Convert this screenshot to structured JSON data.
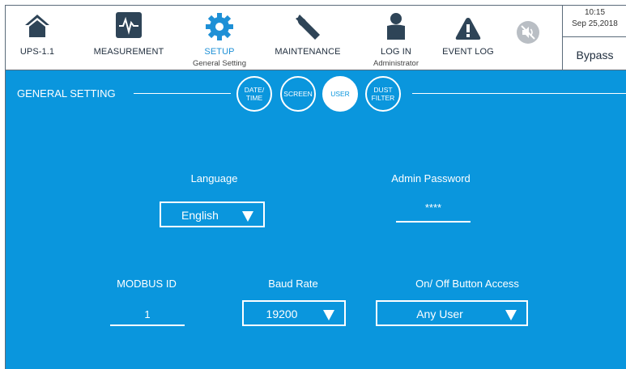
{
  "nav": [
    {
      "label": "UPS-1.1",
      "sub": "",
      "icon": "home-icon"
    },
    {
      "label": "MEASUREMENT",
      "sub": "",
      "icon": "waveform-icon"
    },
    {
      "label": "SETUP",
      "sub": "General Setting",
      "icon": "gear-icon"
    },
    {
      "label": "MAINTENANCE",
      "sub": "",
      "icon": "wrench-icon"
    },
    {
      "label": "LOG IN",
      "sub": "Administrator",
      "icon": "user-icon"
    },
    {
      "label": "EVENT LOG",
      "sub": "",
      "icon": "warning-icon"
    }
  ],
  "status": {
    "time": "10:15",
    "date": "Sep 25,2018",
    "mode": "Bypass",
    "sound_icon": "mute-icon"
  },
  "section": {
    "title": "GENERAL SETTING"
  },
  "tabs": [
    {
      "label": "DATE/\nTIME"
    },
    {
      "label": "SCREEN"
    },
    {
      "label": "USER"
    },
    {
      "label": "DUST\nFILTER"
    }
  ],
  "fields": {
    "language": {
      "label": "Language",
      "value": "English"
    },
    "admin_password": {
      "label": "Admin Password",
      "value": "****"
    },
    "modbus_id": {
      "label": "MODBUS ID",
      "value": "1"
    },
    "baud_rate": {
      "label": "Baud Rate",
      "value": "19200"
    },
    "onoff_access": {
      "label": "On/ Off Button Access",
      "value": "Any User"
    }
  },
  "colors": {
    "accent": "#0a96dd",
    "icon": "#2e4457",
    "active": "#1e90d6"
  }
}
